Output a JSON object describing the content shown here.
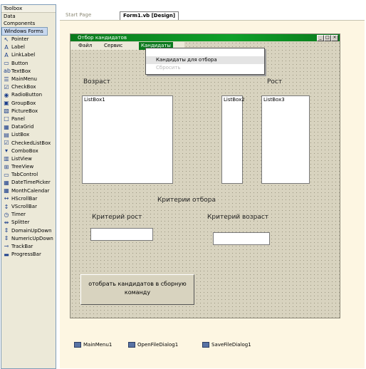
{
  "toolbox": {
    "header": "Toolbox",
    "sections": [
      "Data",
      "Components",
      "Windows Forms"
    ],
    "items": [
      "Pointer",
      "Label",
      "LinkLabel",
      "Button",
      "TextBox",
      "MainMenu",
      "CheckBox",
      "RadioButton",
      "GroupBox",
      "PictureBox",
      "Panel",
      "DataGrid",
      "ListBox",
      "CheckedListBox",
      "ComboBox",
      "ListView",
      "TreeView",
      "TabControl",
      "DateTimePicker",
      "MonthCalendar",
      "HScrollBar",
      "VScrollBar",
      "Timer",
      "Splitter",
      "DomainUpDown",
      "NumericUpDown",
      "TrackBar",
      "ProgressBar"
    ]
  },
  "tabs": [
    "Start Page",
    "Form1.vb [Design]"
  ],
  "form": {
    "title": "Отбор кандидатов",
    "menu": [
      "Файл",
      "Сервис",
      "Кандидаты"
    ],
    "dropdown": [
      "",
      "Кандидаты для отбора",
      "Сбросить"
    ],
    "label_left": "Возраст",
    "label_right": "Рост",
    "listbox_text": "ListBox1",
    "listbox2_text": "ListBox2",
    "listbox3_text": "ListBox3",
    "criteria_title": "Критерии отбора",
    "criteria_height": "Критерий рост",
    "criteria_age": "Критерий возраст",
    "action_button": "отобрать кандидатов в сборную команду"
  },
  "tray": [
    "MainMenu1",
    "OpenFileDialog1",
    "SaveFileDialog1"
  ]
}
